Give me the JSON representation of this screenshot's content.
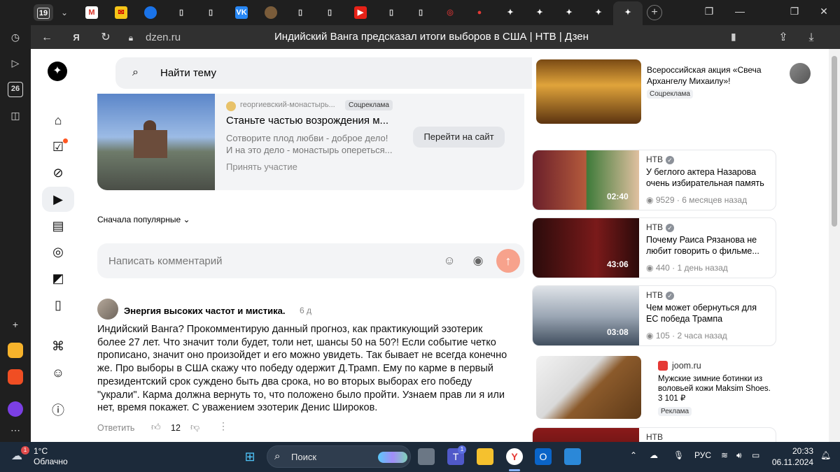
{
  "browser": {
    "tab_count": "19",
    "url": "dzen.ru",
    "page_title": "Индийский Ванга предсказал итоги выборов в США | НТВ | Дзен"
  },
  "sidebar": {
    "date_badge": "26"
  },
  "header": {
    "search_placeholder": "Найти тему"
  },
  "ad": {
    "source": "георгиевский-монастырь...",
    "badge": "Соцреклама",
    "title": "Станьте частью возрождения м...",
    "text_line1": "Сотворите плод любви - доброе дело!",
    "text_line2": "И на это дело - монастырь опереться...",
    "cta": "Перейти на сайт",
    "join": "Принять участие"
  },
  "comments": {
    "sort_label": "Сначала популярные",
    "input_placeholder": "Написать комментарий",
    "items": [
      {
        "author": "Энергия высоких частот и мистика.",
        "time": "6 д",
        "lines": [
          "Индийский Ванга? Прокомментирую данный прогноз, как практикующий эзотерик",
          "более 27 лет. Что значит толи будет, толи нет, шансы 50 на 50?! Если событие четко",
          "прописано, значит оно произойдет и его можно увидеть. Так бывает не всегда конечно",
          "же. Про выборы в США скажу что победу одержит Д.Трамп. Ему по карме в первый",
          "президентский срок суждено быть два срока, но во вторых выборах его победу",
          "\"украли\". Карма должна вернуть то, что положено было пройти. Узнаем прав ли я или",
          "нет, время покажет. С уважением эзотерик Денис Широков."
        ],
        "reply_label": "Ответить",
        "likes": "12"
      }
    ]
  },
  "related": {
    "top_ad": {
      "title_line1": "Всероссийская акция «Свеча",
      "title_line2": "Архангелу Михаилу»!",
      "badge": "Соцреклама"
    },
    "videos": [
      {
        "source": "НТВ",
        "title": "У беглого актера Назарова очень избирательная память",
        "duration": "02:40",
        "views": "9529",
        "age": "6 месяцев назад"
      },
      {
        "source": "НТВ",
        "title": "Почему Раиса Рязанова не любит говорить о фильме...",
        "duration": "43:06",
        "views": "440",
        "age": "1 день назад"
      },
      {
        "source": "НТВ",
        "title": "Чем может обернуться для ЕС победа Трампа",
        "duration": "03:08",
        "views": "105",
        "age": "2 часа назад"
      }
    ],
    "shop_ad": {
      "source": "joom.ru",
      "title": "Мужские зимние ботинки из воловьей кожи Maksim Shoes. 3 101 ₽",
      "badge": "Реклама"
    },
    "partial": {
      "source": "НТВ"
    }
  },
  "taskbar": {
    "weather_badge": "1",
    "temp": "1°C",
    "weather": "Облачно",
    "search_placeholder": "Поиск",
    "teams_badge": "1",
    "lang": "РУС",
    "time": "20:33",
    "date": "06.11.2024"
  },
  "colors": {
    "accent_send": "#f7a28c",
    "taskbar_bg": "#1c2a3a",
    "browser_dark": "#1f1f1f"
  }
}
